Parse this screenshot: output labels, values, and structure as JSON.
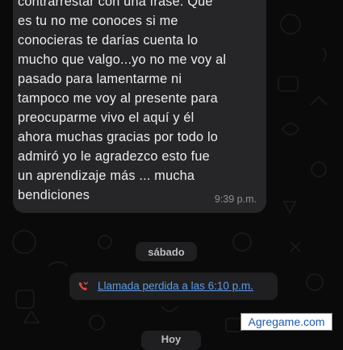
{
  "chat": {
    "message": {
      "lines": [
        "contrarrestar con una frase. Que",
        "es tu no me conoces si me",
        "conocieras te darías cuenta  lo",
        "mucho que valgo...yo  no me voy al",
        "pasado para lamentarme ni",
        "tampoco me voy al presente para",
        "preocuparme vivo el aquí y él",
        "ahora muchas gracias por todo lo",
        "admiró yo  le agradezco esto fue",
        "un aprendizaje más  ... mucha",
        "bendiciones"
      ],
      "time": "9:39 p.m."
    },
    "day_separator": "sábado",
    "missed_call": {
      "text": "Llamada perdida a las 6:10 p.m.",
      "icon": "missed-call-icon",
      "color": "#e5483b"
    },
    "today_separator": "Hoy"
  },
  "watermark": "Agregame.com",
  "colors": {
    "background": "#0a0a0a",
    "bubble": "#262628",
    "link": "#5e9be6"
  }
}
